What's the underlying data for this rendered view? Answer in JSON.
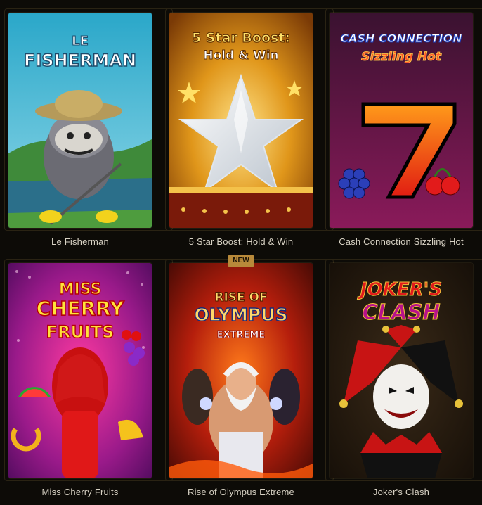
{
  "games": [
    {
      "title": "Le Fisherman",
      "logo": [
        "LE",
        "FISHERMAN"
      ]
    },
    {
      "title": "5 Star Boost: Hold & Win",
      "logo": [
        "5 Star Boost:",
        "Hold & Win"
      ]
    },
    {
      "title": "Cash Connection Sizzling Hot",
      "logo": [
        "CASH CONNECTION",
        "Sizzling Hot"
      ]
    },
    {
      "title": "Miss Cherry Fruits",
      "logo": [
        "MISS",
        "CHERRY",
        "FRUITS"
      ]
    },
    {
      "title": "Rise of Olympus Extreme",
      "badge": "NEW",
      "logo": [
        "RISE OF",
        "OLYMPUS",
        "EXTREME"
      ]
    },
    {
      "title": "Joker's Clash",
      "logo": [
        "JOKER'S",
        "CLASH"
      ]
    }
  ],
  "colors": {
    "background": "#0d0b07",
    "caption": "#d8d2c4",
    "badge": "#b8893a"
  }
}
